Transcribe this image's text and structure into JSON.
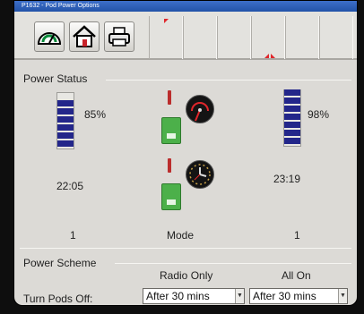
{
  "window": {
    "title": "P1632 - Pod Power Options"
  },
  "toolbar": {
    "buttons": [
      {
        "name": "speedometer-button",
        "icon": "speedometer-icon"
      },
      {
        "name": "home-button",
        "icon": "home-icon"
      },
      {
        "name": "printer-button",
        "icon": "printer-icon"
      }
    ]
  },
  "power_status": {
    "title": "Power Status",
    "left_battery": {
      "percent_label": "85%",
      "fill_fraction": 0.85
    },
    "right_battery": {
      "percent_label": "98%",
      "fill_fraction": 0.98
    },
    "left_time": "22:05",
    "right_time": "23:19",
    "left_count": "1",
    "right_count": "1",
    "mode_label": "Mode"
  },
  "power_scheme": {
    "title": "Power Scheme",
    "col_radio_only": "Radio Only",
    "col_all_on": "All On",
    "row_label": "Turn Pods Off:",
    "radio_only_value": "After 30 mins",
    "all_on_value": "After 30 mins"
  },
  "colors": {
    "battery": "#23268a",
    "pod": "#4cb04a",
    "accent": "#e0262b"
  }
}
